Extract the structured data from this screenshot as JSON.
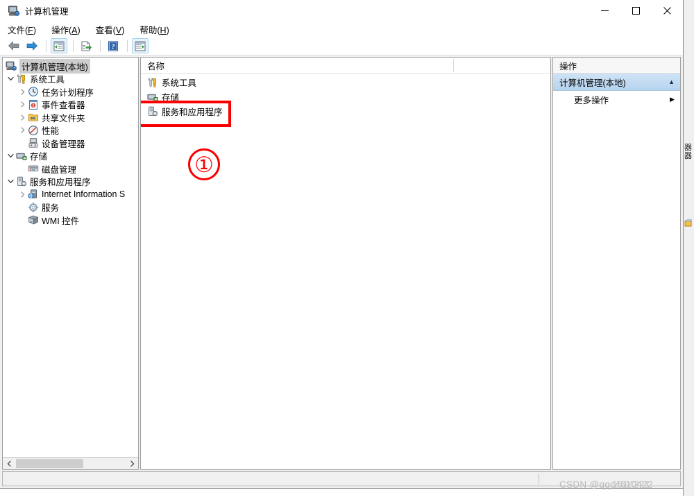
{
  "window": {
    "title": "计算机管理",
    "app_icon": "computer-management-icon",
    "controls": {
      "minimize": "—",
      "maximize": "□",
      "close": "✕"
    }
  },
  "menubar": {
    "items": [
      {
        "label": "文件(F)",
        "pre": "文件(",
        "key": "F",
        "post": ")"
      },
      {
        "label": "操作(A)",
        "pre": "操作(",
        "key": "A",
        "post": ")"
      },
      {
        "label": "查看(V)",
        "pre": "查看(",
        "key": "V",
        "post": ")"
      },
      {
        "label": "帮助(H)",
        "pre": "帮助(",
        "key": "H",
        "post": ")"
      }
    ]
  },
  "toolbar": {
    "buttons": [
      {
        "name": "back-icon",
        "framed": false
      },
      {
        "name": "forward-icon",
        "framed": false
      },
      {
        "name": "show-hide-console-tree-icon",
        "framed": true
      },
      {
        "name": "export-list-icon",
        "framed": false
      },
      {
        "name": "help-icon",
        "framed": false
      },
      {
        "name": "show-hide-action-pane-icon",
        "framed": true
      }
    ]
  },
  "tree": {
    "items": [
      {
        "label": "计算机管理(本地)",
        "indent": 0,
        "twisty": "",
        "icon": "computer-management-icon",
        "selected": true
      },
      {
        "label": "系统工具",
        "indent": 1,
        "twisty": "expanded",
        "icon": "system-tools-icon",
        "selected": false
      },
      {
        "label": "任务计划程序",
        "indent": 2,
        "twisty": "collapsed",
        "icon": "task-scheduler-icon",
        "selected": false
      },
      {
        "label": "事件查看器",
        "indent": 2,
        "twisty": "collapsed",
        "icon": "event-viewer-icon",
        "selected": false
      },
      {
        "label": "共享文件夹",
        "indent": 2,
        "twisty": "collapsed",
        "icon": "shared-folders-icon",
        "selected": false
      },
      {
        "label": "性能",
        "indent": 2,
        "twisty": "collapsed",
        "icon": "performance-icon",
        "selected": false
      },
      {
        "label": "设备管理器",
        "indent": 2,
        "twisty": "",
        "icon": "device-manager-icon",
        "selected": false
      },
      {
        "label": "存储",
        "indent": 1,
        "twisty": "expanded",
        "icon": "storage-icon",
        "selected": false
      },
      {
        "label": "磁盘管理",
        "indent": 2,
        "twisty": "",
        "icon": "disk-management-icon",
        "selected": false
      },
      {
        "label": "服务和应用程序",
        "indent": 1,
        "twisty": "expanded",
        "icon": "services-and-applications-icon",
        "selected": false
      },
      {
        "label": "Internet Information S",
        "indent": 2,
        "twisty": "collapsed",
        "icon": "iis-icon",
        "selected": false
      },
      {
        "label": "服务",
        "indent": 2,
        "twisty": "",
        "icon": "services-icon",
        "selected": false
      },
      {
        "label": "WMI 控件",
        "indent": 2,
        "twisty": "",
        "icon": "wmi-control-icon",
        "selected": false
      }
    ]
  },
  "list": {
    "columns": [
      "名称"
    ],
    "rows": [
      {
        "label": "系统工具",
        "icon": "system-tools-icon"
      },
      {
        "label": "存储",
        "icon": "storage-icon"
      },
      {
        "label": "服务和应用程序",
        "icon": "services-and-applications-icon"
      }
    ]
  },
  "annotations": {
    "highlight_color": "#fb0000",
    "step_marker": "①",
    "highlight_target": "服务和应用程序"
  },
  "actions": {
    "header": "操作",
    "group_title": "计算机管理(本地)",
    "group_caret": "▲",
    "items": [
      {
        "label": "更多操作",
        "caret": "▶"
      }
    ]
  },
  "statusbar": {
    "text": ""
  },
  "watermark": {
    "text": "CSDN @qqc4610422",
    "overlap_text": "1614221"
  },
  "behind_window": {
    "sliver_text_1": "器",
    "sliver_text_2": "器"
  }
}
